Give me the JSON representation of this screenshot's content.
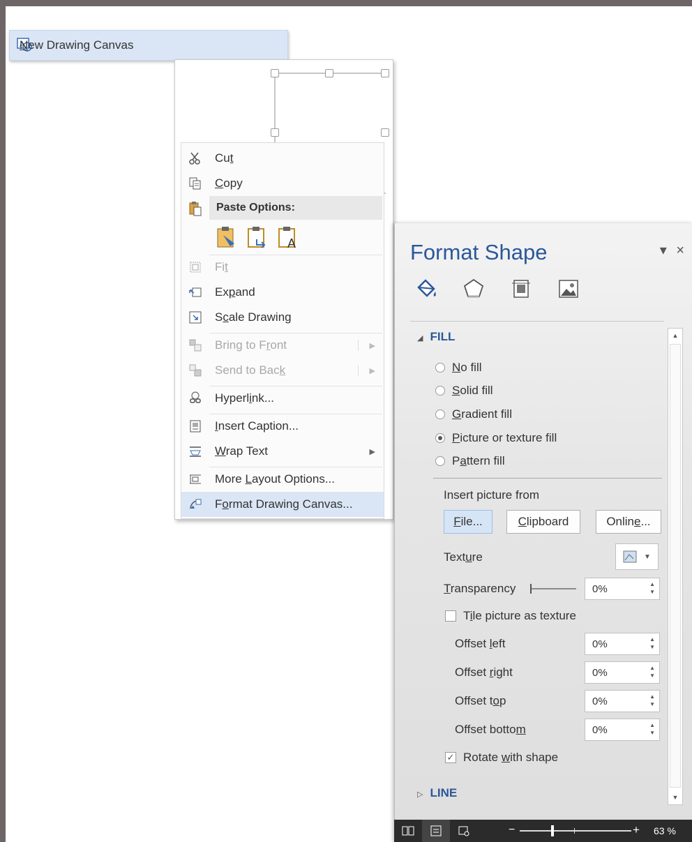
{
  "canvas_menu": {
    "label_first": "N",
    "label_rest": "ew Drawing Canvas"
  },
  "context_menu": {
    "cut": {
      "pre": "Cu",
      "key": "t",
      "post": ""
    },
    "copy": {
      "pre": "",
      "key": "C",
      "post": "opy"
    },
    "paste_options": "Paste Options:",
    "fit": {
      "pre": "Fi",
      "key": "t",
      "post": ""
    },
    "expand": {
      "pre": "Ex",
      "key": "p",
      "post": "and"
    },
    "scale_drawing": {
      "pre": "S",
      "key": "c",
      "post": "ale Drawing"
    },
    "bring_to_front": {
      "pre": "Bring to F",
      "key": "r",
      "post": "ont"
    },
    "send_to_back": {
      "pre": "Send to Bac",
      "key": "k",
      "post": ""
    },
    "hyperlink": {
      "pre": "Hyperl",
      "key": "i",
      "post": "nk..."
    },
    "insert_caption": {
      "pre": "",
      "key": "I",
      "post": "nsert Caption..."
    },
    "wrap_text": {
      "pre": "",
      "key": "W",
      "post": "rap Text"
    },
    "more_layout": {
      "pre": "More ",
      "key": "L",
      "post": "ayout Options..."
    },
    "format_canvas": {
      "pre": "F",
      "key": "o",
      "post": "rmat Drawing Canvas..."
    }
  },
  "pane": {
    "title": "Format Shape",
    "dropdown_glyph": "▾",
    "close_glyph": "×",
    "tabs": [
      "fill-line-icon",
      "effects-icon",
      "layout-properties-icon",
      "picture-icon"
    ],
    "fill_section": "FILL",
    "line_section": "LINE",
    "fill_options": [
      {
        "key": "N",
        "rest": "o fill",
        "selected": false
      },
      {
        "key": "S",
        "rest": "olid fill",
        "selected": false
      },
      {
        "key": "G",
        "rest": "radient fill",
        "selected": false
      },
      {
        "key": "P",
        "rest": "icture or texture fill",
        "selected": true
      },
      {
        "pre": "P",
        "key": "a",
        "rest": "ttern fill",
        "selected": false
      }
    ],
    "insert_from": "Insert picture from",
    "btn_file": {
      "key": "F",
      "rest": "ile..."
    },
    "btn_clipboard": {
      "key": "C",
      "rest": "lipboard"
    },
    "btn_online": {
      "pre": "Onlin",
      "key": "e",
      "rest": "..."
    },
    "texture": {
      "pre": "Text",
      "key": "u",
      "rest": "re"
    },
    "transparency": {
      "key": "T",
      "rest": "ransparency",
      "value": "0%"
    },
    "tile": {
      "pre": "T",
      "key": "i",
      "rest": "le picture as texture",
      "checked": false
    },
    "offset_left": {
      "pre": "Offset ",
      "key": "l",
      "rest": "eft",
      "value": "0%"
    },
    "offset_right": {
      "pre": "Offset ",
      "key": "r",
      "rest": "ight",
      "value": "0%"
    },
    "offset_top": {
      "pre": "Offset t",
      "key": "o",
      "rest": "p",
      "value": "0%"
    },
    "offset_bottom": {
      "pre": "Offset botto",
      "key": "m",
      "rest": "",
      "value": "0%"
    },
    "rotate": {
      "pre": "Rotate ",
      "key": "w",
      "rest": "ith shape",
      "checked": true
    }
  },
  "statusbar": {
    "zoom": "63 %",
    "minus": "−",
    "plus": "+"
  }
}
